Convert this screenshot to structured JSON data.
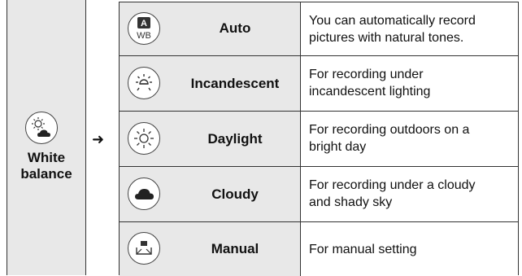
{
  "category": {
    "icon": "daylight-cloud-icon",
    "label_line1": "White",
    "label_line2": "balance"
  },
  "arrow": "➜",
  "modes": [
    {
      "icon": "auto-wb-icon",
      "icon_text_top": "A",
      "icon_text_bottom": "WB",
      "label": "Auto",
      "desc_line1": "You can automatically record",
      "desc_line2": "pictures with natural tones."
    },
    {
      "icon": "incandescent-icon",
      "label": "Incandescent",
      "desc_line1": "For recording under",
      "desc_line2": "incandescent lighting"
    },
    {
      "icon": "daylight-sun-icon",
      "label": "Daylight",
      "desc_line1": "For recording outdoors on a",
      "desc_line2": "bright day"
    },
    {
      "icon": "cloud-icon",
      "label": "Cloudy",
      "desc_line1": "For recording under a cloudy",
      "desc_line2": "and shady sky"
    },
    {
      "icon": "manual-wb-icon",
      "label": "Manual",
      "desc_line1": "For manual setting",
      "desc_line2": ""
    }
  ]
}
